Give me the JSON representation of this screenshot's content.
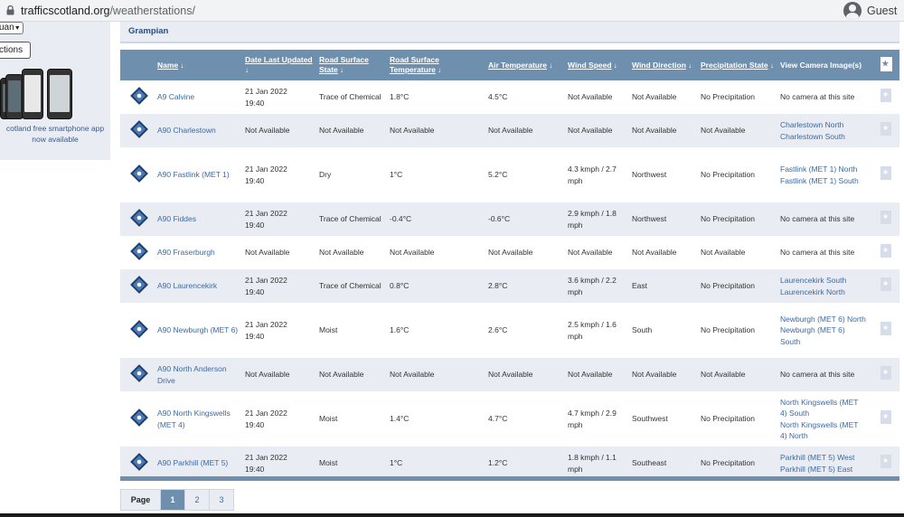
{
  "browser": {
    "url_host": "trafficscotland.org",
    "url_path": "/weatherstations/",
    "profile_label": "Guest"
  },
  "sidebar": {
    "select_value": "uan",
    "directions_button": "ctions",
    "app_text_line1": "cotland free smartphone app",
    "app_text_line2": "now available"
  },
  "region": {
    "title": "Grampian"
  },
  "table": {
    "headers": [
      "Name",
      "Date Last Updated",
      "Road Surface State",
      "Road Surface Temperature",
      "Air Temperature",
      "Wind Speed",
      "Wind Direction",
      "Precipitation State",
      "View Camera Image(s)"
    ],
    "rows": [
      {
        "name": "A9 Calvine",
        "date": "21 Jan 2022",
        "time": "19:40",
        "surface": "Trace of Chemical",
        "surface_temp": "1.8°C",
        "air_temp": "4.5°C",
        "wind_speed": "Not Available",
        "wind_dir": "Not Available",
        "precip": "No Precipitation",
        "cameras": [
          "No camera at this site"
        ],
        "camera_links": false
      },
      {
        "name": "A90 Charlestown",
        "date": "Not Available",
        "time": "",
        "surface": "Not Available",
        "surface_temp": "Not Available",
        "air_temp": "Not Available",
        "wind_speed": "Not Available",
        "wind_dir": "Not Available",
        "precip": "Not Available",
        "cameras": [
          "Charlestown North",
          "Charlestown South"
        ],
        "camera_links": true
      },
      {
        "name": "A90 Fastlink (MET 1)",
        "date": "21 Jan 2022",
        "time": "19:40",
        "surface": "Dry",
        "surface_temp": "1°C",
        "air_temp": "5.2°C",
        "wind_speed": "4.3 kmph / 2.7 mph",
        "wind_dir": "Northwest",
        "precip": "No Precipitation",
        "cameras": [
          "Fastlink (MET 1) North",
          "Fastlink (MET 1) South"
        ],
        "camera_links": true
      },
      {
        "name": "A90 Fiddes",
        "date": "21 Jan 2022",
        "time": "19:40",
        "surface": "Trace of Chemical",
        "surface_temp": "-0.4°C",
        "air_temp": "-0.6°C",
        "wind_speed": "2.9 kmph / 1.8 mph",
        "wind_dir": "Northwest",
        "precip": "No Precipitation",
        "cameras": [
          "No camera at this site"
        ],
        "camera_links": false
      },
      {
        "name": "A90 Fraserburgh",
        "date": "Not Available",
        "time": "",
        "surface": "Not Available",
        "surface_temp": "Not Available",
        "air_temp": "Not Available",
        "wind_speed": "Not Available",
        "wind_dir": "Not Available",
        "precip": "Not Available",
        "cameras": [
          "No camera at this site"
        ],
        "camera_links": false
      },
      {
        "name": "A90 Laurencekirk",
        "date": "21 Jan 2022",
        "time": "19:40",
        "surface": "Trace of Chemical",
        "surface_temp": "0.8°C",
        "air_temp": "2.8°C",
        "wind_speed": "3.6 kmph / 2.2 mph",
        "wind_dir": "East",
        "precip": "No Precipitation",
        "cameras": [
          "Laurencekirk South",
          "Laurencekirk North"
        ],
        "camera_links": true
      },
      {
        "name": "A90 Newburgh (MET 6)",
        "date": "21 Jan 2022",
        "time": "19:40",
        "surface": "Moist",
        "surface_temp": "1.6°C",
        "air_temp": "2.6°C",
        "wind_speed": "2.5 kmph / 1.6 mph",
        "wind_dir": "South",
        "precip": "No Precipitation",
        "cameras": [
          "Newburgh (MET 6) North",
          "Newburgh (MET 6) South"
        ],
        "camera_links": true
      },
      {
        "name": "A90 North Anderson Drive",
        "date": "Not Available",
        "time": "",
        "surface": "Not Available",
        "surface_temp": "Not Available",
        "air_temp": "Not Available",
        "wind_speed": "Not Available",
        "wind_dir": "Not Available",
        "precip": "Not Available",
        "cameras": [
          "No camera at this site"
        ],
        "camera_links": false
      },
      {
        "name": "A90 North Kingswells (MET 4)",
        "date": "21 Jan 2022",
        "time": "19:40",
        "surface": "Moist",
        "surface_temp": "1.4°C",
        "air_temp": "4.7°C",
        "wind_speed": "4.7 kmph / 2.9 mph",
        "wind_dir": "Southwest",
        "precip": "No Precipitation",
        "cameras": [
          "North Kingswells (MET 4) South",
          "North Kingswells (MET 4) North"
        ],
        "camera_links": true
      },
      {
        "name": "A90 Parkhill (MET 5)",
        "date": "21 Jan 2022",
        "time": "19:40",
        "surface": "Moist",
        "surface_temp": "1°C",
        "air_temp": "1.2°C",
        "wind_speed": "1.8 kmph / 1.1 mph",
        "wind_dir": "Southeast",
        "precip": "No Precipitation",
        "cameras": [
          "Parkhill (MET 5) West",
          "Parkhill (MET 5) East"
        ],
        "camera_links": true
      }
    ]
  },
  "pagination": {
    "label": "Page",
    "pages": [
      "1",
      "2",
      "3"
    ],
    "active": "1"
  },
  "colors": {
    "header_bg": "#6f8fae",
    "link": "#3c6aa1",
    "stripe": "#e9ecf2",
    "icon_navy": "#1f3f6b"
  },
  "icons": {
    "station": "weather-station-diamond-icon",
    "bookmark": "bookmark-star-icon",
    "sort": "sort-arrow-icon"
  }
}
